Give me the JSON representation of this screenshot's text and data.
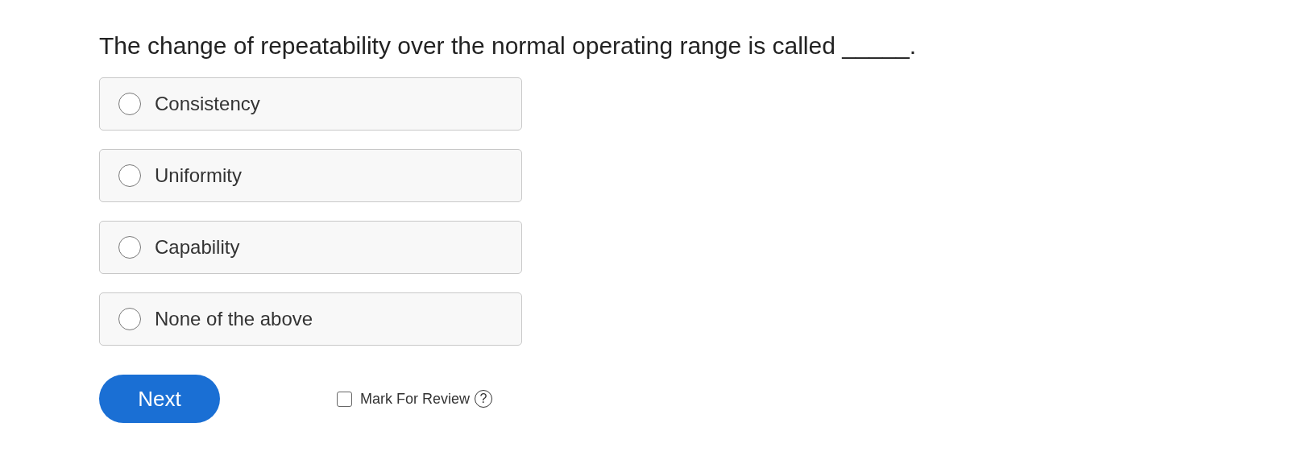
{
  "question": "The change of repeatability over the normal operating range is called _____.",
  "options": [
    {
      "label": "Consistency",
      "selected": false
    },
    {
      "label": "Uniformity",
      "selected": false
    },
    {
      "label": "Capability",
      "selected": false
    },
    {
      "label": "None of the above",
      "selected": false
    }
  ],
  "next_button": "Next",
  "mark_for_review": {
    "label": "Mark For Review",
    "checked": false,
    "help": "?"
  }
}
